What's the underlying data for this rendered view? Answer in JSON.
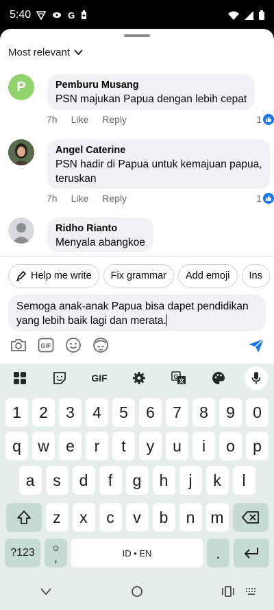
{
  "status": {
    "time": "5:40"
  },
  "sort": {
    "label": "Most relevant"
  },
  "comments": [
    {
      "author": "Pemburu Musang",
      "initial": "P",
      "text": "PSN majukan Papua dengan lebih cepat",
      "time": "7h",
      "like": "Like",
      "reply": "Reply",
      "likes": "1"
    },
    {
      "author": "Angel Caterine",
      "text_line1": "PSN hadir di Papua untuk kemajuan papua,",
      "text_line2": "teruskan",
      "time": "7h",
      "like": "Like",
      "reply": "Reply",
      "likes": "1"
    },
    {
      "author": "Ridho Rianto",
      "text": "Menyala abangkoe"
    }
  ],
  "chips": [
    "Help me write",
    "Fix grammar",
    "Add emoji",
    "Ins"
  ],
  "composer": {
    "line1": "Semoga anak-anak Papua bisa dapet pendidikan",
    "line2": "yang lebih baik lagi dan merata."
  },
  "keyboard": {
    "gif_label": "GIF",
    "numbers": [
      "1",
      "2",
      "3",
      "4",
      "5",
      "6",
      "7",
      "8",
      "9",
      "0"
    ],
    "row1": [
      "q",
      "w",
      "e",
      "r",
      "t",
      "y",
      "u",
      "i",
      "o",
      "p"
    ],
    "row2": [
      "a",
      "s",
      "d",
      "f",
      "g",
      "h",
      "j",
      "k",
      "l"
    ],
    "row3": [
      "z",
      "x",
      "c",
      "v",
      "b",
      "n",
      "m"
    ],
    "symbols_label": "?123",
    "comma": ",",
    "space_label": "ID • EN",
    "period": "."
  },
  "colors": {
    "accent": "#1877f2",
    "keyboard_bg": "#e6eeea",
    "key_dark": "#c6dbd2"
  }
}
